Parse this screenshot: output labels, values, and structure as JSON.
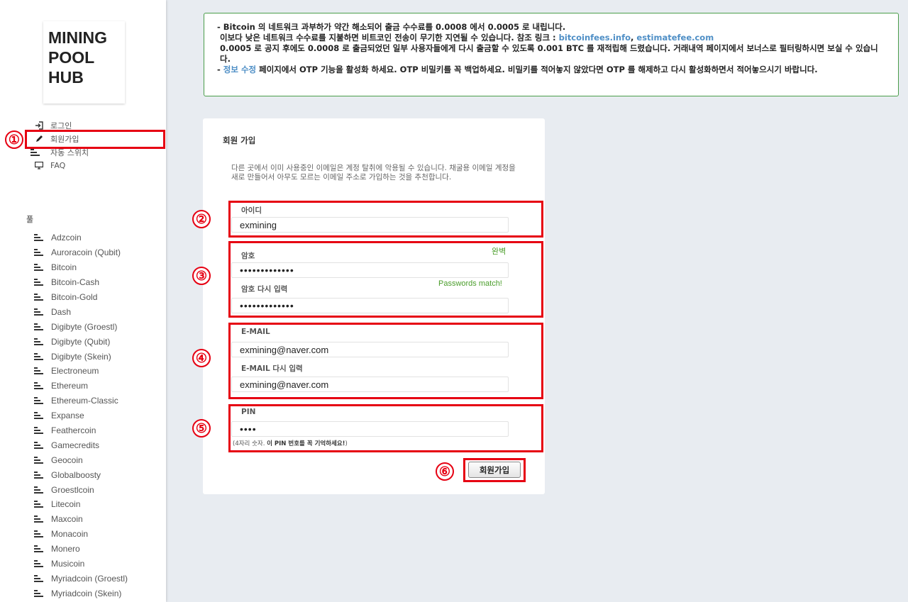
{
  "logo": [
    "MINING",
    "POOL",
    "HUB"
  ],
  "nav": [
    {
      "label": "로그인",
      "icon": "login-icon"
    },
    {
      "label": "회원가입",
      "icon": "pencil-icon"
    },
    {
      "label": "자동 스위치",
      "icon": "bars-icon"
    },
    {
      "label": "FAQ",
      "icon": "monitor-icon"
    }
  ],
  "pools_title": "풀",
  "pools": [
    "Adzcoin",
    "Auroracoin (Qubit)",
    "Bitcoin",
    "Bitcoin-Cash",
    "Bitcoin-Gold",
    "Dash",
    "Digibyte (Groestl)",
    "Digibyte (Qubit)",
    "Digibyte (Skein)",
    "Electroneum",
    "Ethereum",
    "Ethereum-Classic",
    "Expanse",
    "Feathercoin",
    "Gamecredits",
    "Geocoin",
    "Globalboosty",
    "Groestlcoin",
    "Litecoin",
    "Maxcoin",
    "Monacoin",
    "Monero",
    "Musicoin",
    "Myriadcoin (Groestl)",
    "Myriadcoin (Skein)"
  ],
  "notice": {
    "line1_prefix": "- ",
    "line1_bitcoin": "Bitcoin",
    "line1_rest": " 의 네트워크 과부하가 약간 해소되어 출금 수수료를 0.0008 에서 0.0005 로 내립니다.",
    "line2": "이보다 낮은 네트워크 수수료를 지불하면 비트코인 전송이 무기한 지연될 수 있습니다. 참조 링크 : ",
    "link1": "bitcoinfees.info",
    "link_sep": ", ",
    "link2": "estimatefee.com",
    "line3": "0.0005 로 공지 후에도 0.0008 로 출금되었던 일부 사용자들에게 다시 출금할 수 있도록 0.001 BTC 를 재적립해 드렸습니다. 거래내역 페이지에서 보너스로 필터링하시면 보실 수 있습니다.",
    "line4_prefix": "- ",
    "line4_link": "정보 수정",
    "line4_rest": " 페이지에서 OTP 기능을 활성화 하세요. OTP 비밀키를 꼭 백업하세요. 비밀키를 적어놓지 않았다면 OTP 를 해제하고 다시 활성화하면서 적어놓으시기 바랍니다."
  },
  "form": {
    "title": "회원 가입",
    "description": "다른 곳에서 이미 사용중인 이메일은 계정 탈취에 악용될 수 있습니다. 채굴용 이메일 계정을 새로 만들어서 아무도 모르는 이메일 주소로 가입하는 것을 추천합니다.",
    "username_label": "아이디",
    "username_value": "exmining",
    "password_label": "암호",
    "password_strength": "완벽",
    "password_value": "•••••••••••••",
    "password_confirm_label": "암호 다시 입력",
    "password_match": "Passwords match!",
    "password_confirm_value": "•••••••••••••",
    "email_label": "E-MAIL",
    "email_value": "exmining@naver.com",
    "email_confirm_label": "E-MAIL 다시 입력",
    "email_confirm_value": "exmining@naver.com",
    "pin_label": "PIN",
    "pin_value": "••••",
    "pin_hint_prefix": "(4자리 숫자. ",
    "pin_hint_bold": "이 PIN 번호를 꼭 기억하세요!",
    "pin_hint_suffix": ")",
    "submit_label": "회원가입"
  },
  "annotations": [
    "①",
    "②",
    "③",
    "④",
    "⑤",
    "⑥"
  ],
  "colors": {
    "annotation": "#e60012",
    "notice_border": "#4a9d4a",
    "link": "#4f8fc6",
    "success": "#4a9d2a"
  }
}
